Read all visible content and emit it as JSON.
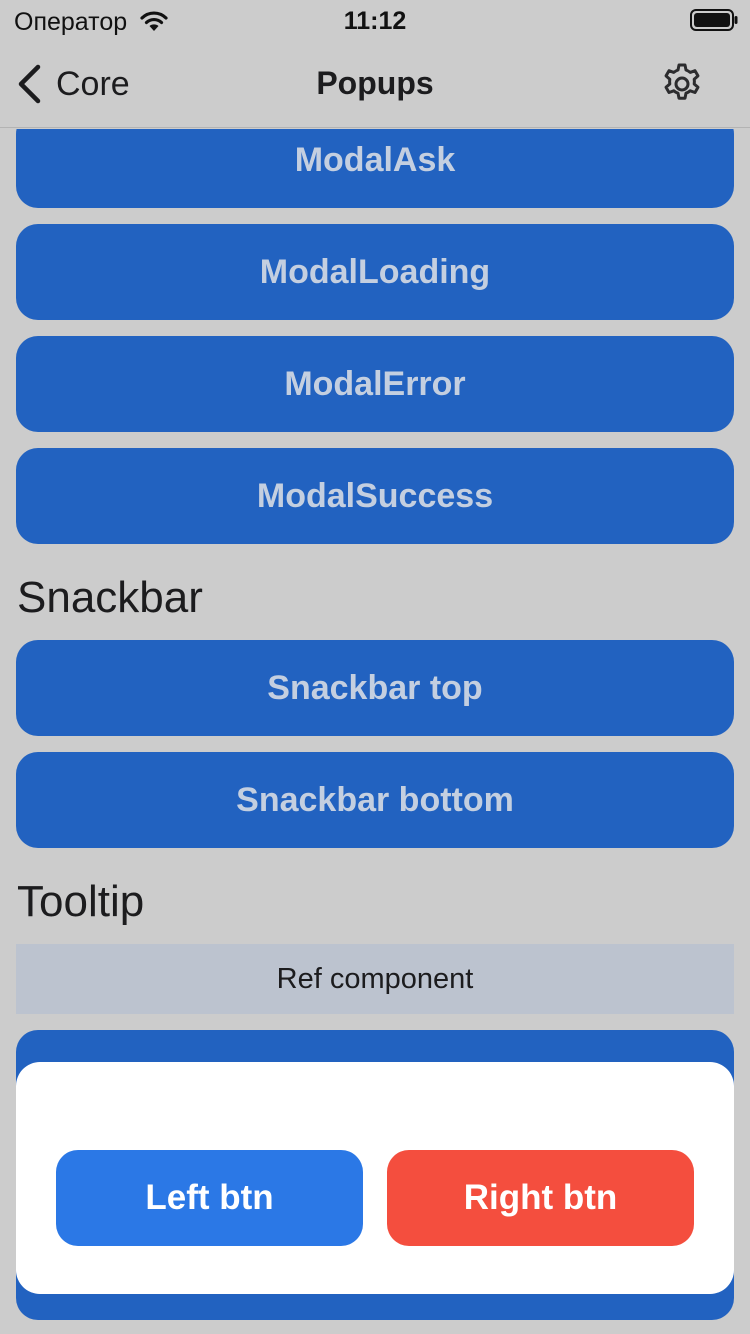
{
  "status_bar": {
    "carrier": "Оператор",
    "time": "11:12"
  },
  "nav": {
    "back_label": "Core",
    "title": "Popups"
  },
  "buttons_modal": {
    "ask": "ModalAsk",
    "loading": "ModalLoading",
    "error": "ModalError",
    "success": "ModalSuccess"
  },
  "sections": {
    "snackbar": "Snackbar",
    "tooltip": "Tooltip"
  },
  "buttons_snackbar": {
    "top": "Snackbar top",
    "bottom": "Snackbar bottom"
  },
  "ref_component": "Ref component",
  "popup": {
    "left_btn": "Left btn",
    "right_btn": "Right btn"
  },
  "colors": {
    "background": "#cccccc",
    "primary_button": "#2262c0",
    "popup_left": "#2b78e6",
    "popup_right": "#f44e3e"
  },
  "icons": [
    "wifi-icon",
    "battery-icon",
    "back-chevron-icon",
    "gear-icon"
  ]
}
